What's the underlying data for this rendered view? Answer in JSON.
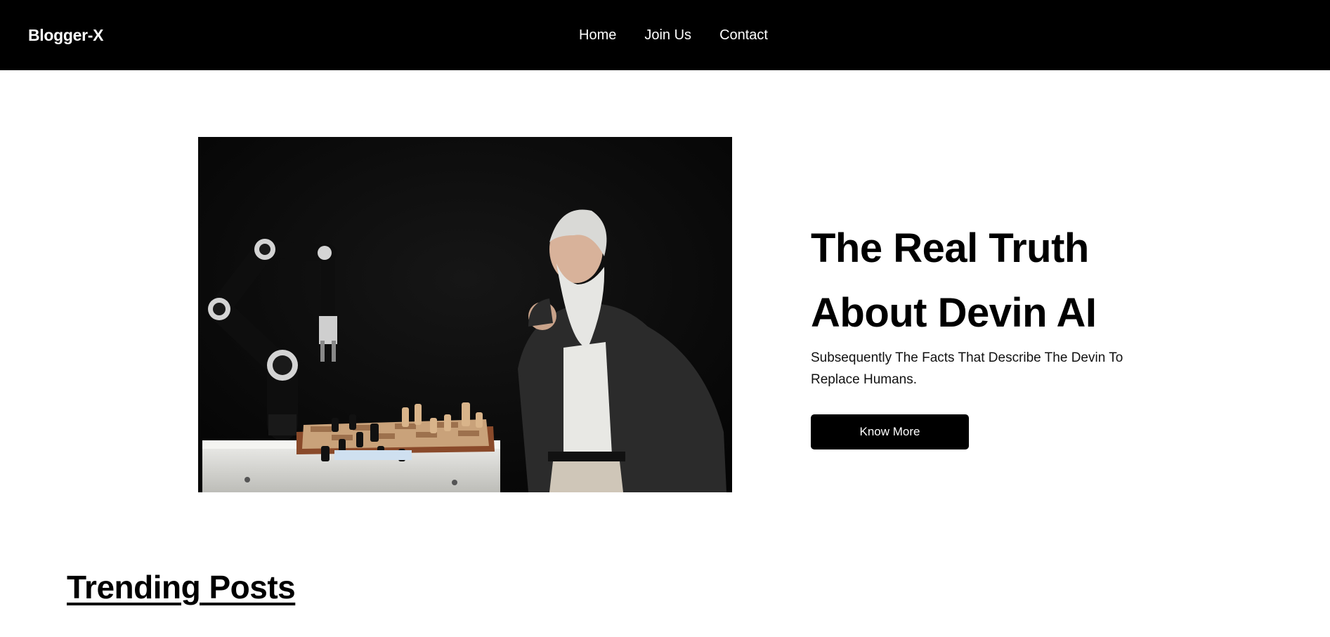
{
  "nav": {
    "brand": "Blogger-X",
    "links": [
      "Home",
      "Join Us",
      "Contact"
    ]
  },
  "hero": {
    "image_icon": "robot-chess-photo",
    "title": "The Real Truth About Devin AI",
    "subtitle": "Subsequently The Facts That Describe The Devin To Replace Humans.",
    "button_label": "Know More"
  },
  "trending": {
    "title": "Trending Posts"
  },
  "colors": {
    "navbar_bg": "#000000",
    "button_bg": "#000000",
    "page_bg": "#ffffff"
  }
}
